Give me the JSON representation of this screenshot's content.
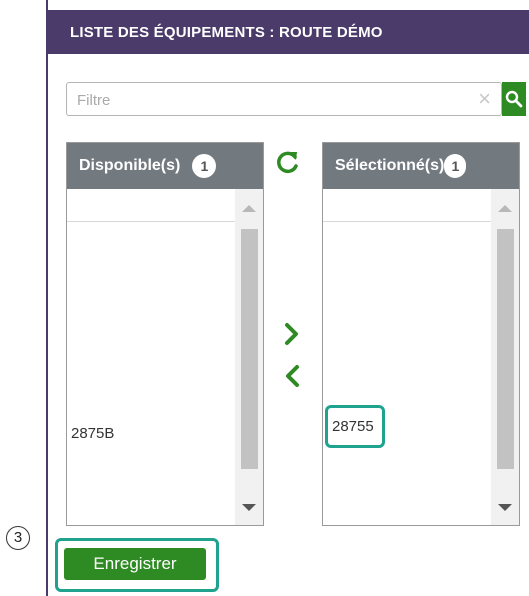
{
  "header": {
    "title": "LISTE DES ÉQUIPEMENTS : ROUTE DÉMO"
  },
  "filter": {
    "placeholder": "Filtre",
    "value": "",
    "clear_icon": "×"
  },
  "available": {
    "title": "Disponible(s)",
    "count": "1",
    "items": [
      "2875B"
    ]
  },
  "selected": {
    "title": "Sélectionné(s)",
    "count": "1",
    "items": [
      "28755"
    ]
  },
  "annotation": {
    "step": "3"
  },
  "actions": {
    "save_label": "Enregistrer"
  },
  "colors": {
    "header_bg": "#4b3b6b",
    "accent_green": "#2e8a22",
    "highlight": "#1fa38f",
    "list_header": "#727a80"
  }
}
